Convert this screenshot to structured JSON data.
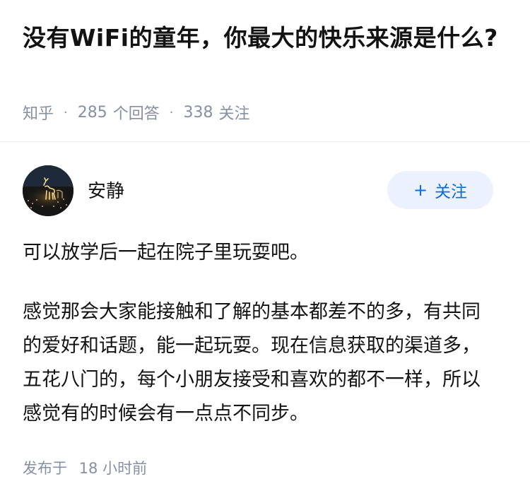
{
  "question": {
    "title": "没有WiFi的童年，你最大的快乐来源是什么?",
    "source": "知乎",
    "answer_count": "285",
    "answer_label": "个回答",
    "follower_count": "338",
    "follower_label": "关注"
  },
  "author": {
    "name": "安静",
    "follow_plus": "+",
    "follow_label": "关注"
  },
  "answer": {
    "paragraphs": [
      "可以放学后一起在院子里玩耍吧。",
      "感觉那会大家能接触和了解的基本都差不的多，有共同的爱好和话题，能一起玩耍。现在信息获取的渠道多，五花八门的，每个小朋友接受和喜欢的都不一样，所以感觉有的时候会有一点点不同步。"
    ],
    "published_label": "发布于",
    "published_time": "18 小时前"
  },
  "colors": {
    "accent": "#056de8",
    "accent_bg": "#ebf2fd",
    "meta_text": "#8590a6",
    "body_text": "#121212",
    "divider": "#ebebeb"
  }
}
